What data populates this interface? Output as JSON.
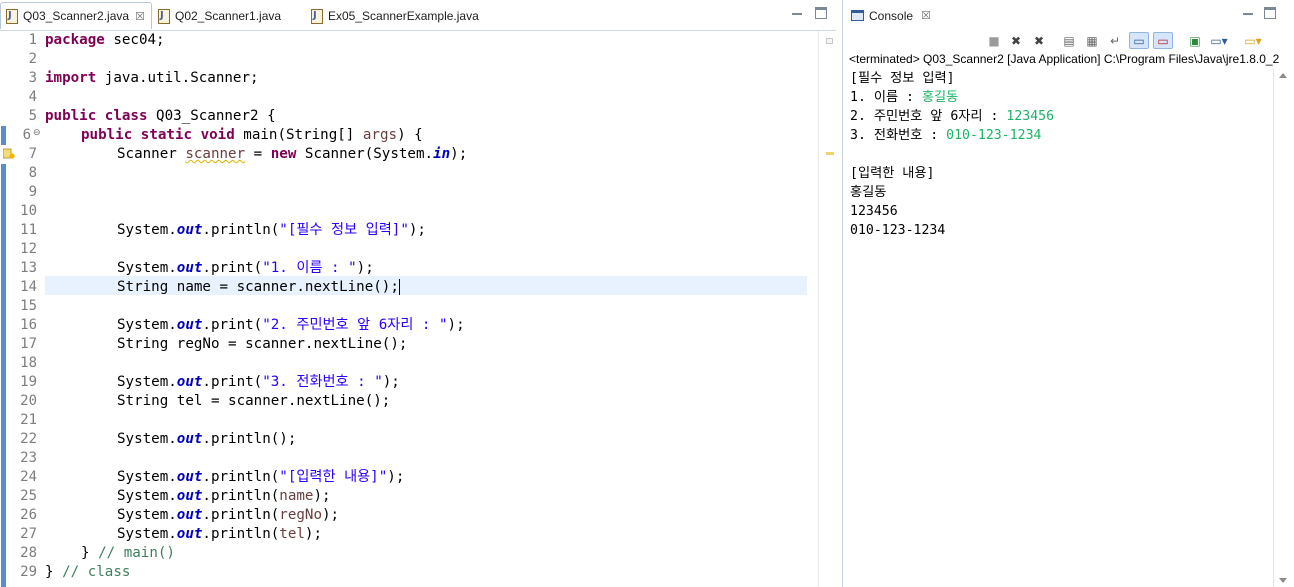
{
  "editor": {
    "tabs": [
      {
        "label": "Q03_Scanner2.java",
        "close": "☒"
      },
      {
        "label": "Q02_Scanner1.java"
      },
      {
        "label": "Ex05_ScannerExample.java"
      }
    ],
    "code_tokens": {
      "package": "package",
      "import": "import",
      "public": "public",
      "class": "class",
      "static": "static",
      "void": "void",
      "new": "new",
      "String": "String",
      "l1_rest": " sec04;",
      "l3_rest": " java.util.Scanner;",
      "l5_rest": " Q03_Scanner2 {",
      "l6_main": " main(String[] ",
      "l6_args": "args",
      "l6_end": ") {",
      "l7_scanner_type": "Scanner ",
      "l7_scanner_var": "scanner",
      "l7_eq": " = ",
      "l7_ctor": " Scanner(System.",
      "in": "in",
      "l7_end": ");",
      "sys": "System.",
      "out": "out",
      "println": ".println(",
      "print": ".print(",
      "end": ");",
      "s11": "\"[필수 정보 입력]\"",
      "s13": "\"1. 이름 : \"",
      "s16": "\"2. 주민번호 앞 6자리 : \"",
      "s19": "\"3. 전화번호 : \"",
      "s24": "\"[입력한 내용]\"",
      "l14_decl": " name = ",
      "l17_decl": " regNo = ",
      "l20_decl": " tel = ",
      "nextLine": "scanner.nextLine();",
      "name": "name",
      "regNo": "regNo",
      "tel": "tel",
      "l28_close": "} ",
      "l28_cmt": "// main()",
      "l29_close": "} ",
      "l29_cmt": "// class"
    },
    "line_numbers": [
      "1",
      "2",
      "3",
      "4",
      "5",
      "6",
      "7",
      "8",
      "9",
      "10",
      "11",
      "12",
      "13",
      "14",
      "15",
      "16",
      "17",
      "18",
      "19",
      "20",
      "21",
      "22",
      "23",
      "24",
      "25",
      "26",
      "27",
      "28",
      "29"
    ]
  },
  "console": {
    "tab_label": "Console",
    "tab_close": "☒",
    "header": "<terminated> Q03_Scanner2 [Java Application] C:\\Program Files\\Java\\jre1.8.0_2",
    "lines": {
      "l1": "[필수 정보 입력]",
      "l2_prompt": "1. 이름 : ",
      "l2_input": "홍길동",
      "l3_prompt": "2. 주민번호 앞 6자리 : ",
      "l3_input": "123456",
      "l4_prompt": "3. 전화번호 : ",
      "l4_input": "010-123-1234",
      "l6": "[입력한 내용]",
      "l7": "홍길동",
      "l8": "123456",
      "l9": "010-123-1234"
    }
  },
  "colors": {
    "keyword": "#7f0055",
    "string": "#2a00ff",
    "field": "#0000c0",
    "comment": "#3f7f5f",
    "console_input": "#19b565",
    "current_line": "#e8f2fe"
  },
  "icons": [
    "java-file-icon",
    "close-icon",
    "minimize-icon",
    "maximize-icon",
    "console-icon",
    "terminate-icon",
    "remove-launch-icon",
    "remove-all-icon",
    "clear-console-icon",
    "scroll-lock-icon",
    "word-wrap-icon",
    "show-on-stdout-icon",
    "show-on-stderr-icon",
    "pin-console-icon",
    "display-console-icon",
    "open-console-icon",
    "warning-icon",
    "fold-icon"
  ]
}
